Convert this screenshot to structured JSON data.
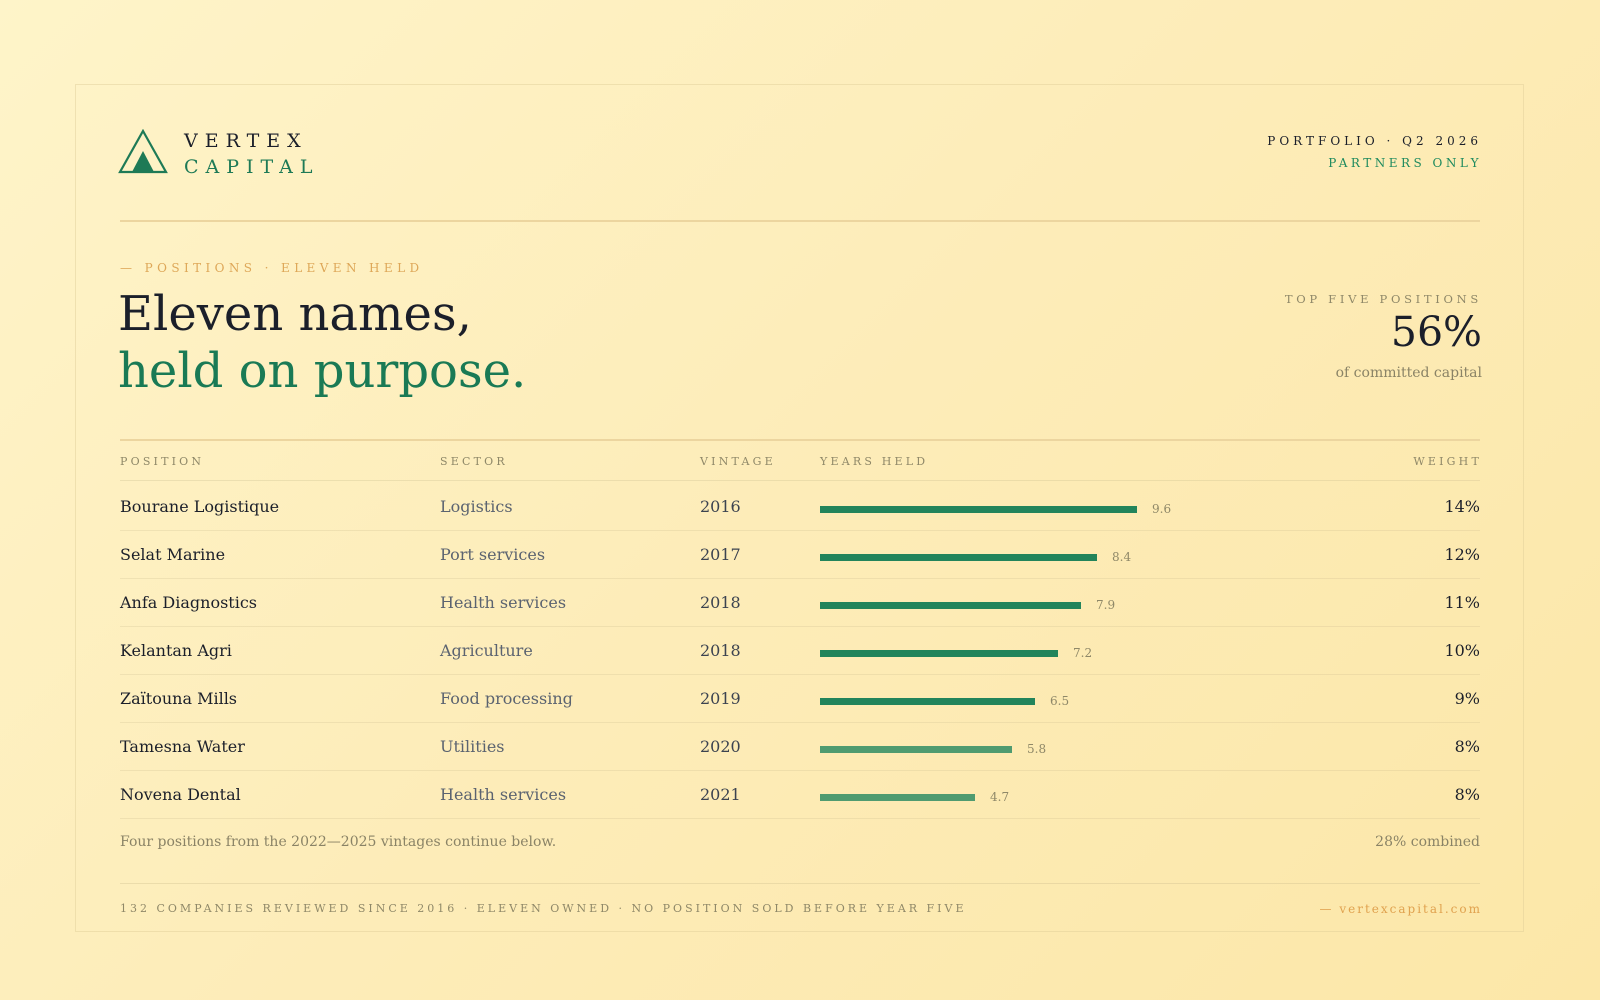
{
  "brand": {
    "line1": "VERTEX",
    "line2": "CAPITAL"
  },
  "header": {
    "meta_line1": "PORTFOLIO · Q2 2026",
    "meta_line2": "PARTNERS ONLY"
  },
  "kicker": "— POSITIONS · ELEVEN HELD",
  "headline": {
    "line1": "Eleven names,",
    "line2": "held on purpose."
  },
  "stat": {
    "label": "TOP FIVE POSITIONS",
    "value": "56%",
    "sub": "of committed capital"
  },
  "table": {
    "columns": [
      "POSITION",
      "SECTOR",
      "VINTAGE",
      "YEARS HELD",
      "WEIGHT"
    ],
    "max_years": 9.6,
    "rows": [
      {
        "name": "Bourane Logistique",
        "sector": "Logistics",
        "vintage": "2016",
        "years": 9.6,
        "years_label": "9.6",
        "weight": "14%"
      },
      {
        "name": "Selat Marine",
        "sector": "Port services",
        "vintage": "2017",
        "years": 8.4,
        "years_label": "8.4",
        "weight": "12%"
      },
      {
        "name": "Anfa Diagnostics",
        "sector": "Health services",
        "vintage": "2018",
        "years": 7.9,
        "years_label": "7.9",
        "weight": "11%"
      },
      {
        "name": "Kelantan Agri",
        "sector": "Agriculture",
        "vintage": "2018",
        "years": 7.2,
        "years_label": "7.2",
        "weight": "10%"
      },
      {
        "name": "Zaïtouna Mills",
        "sector": "Food processing",
        "vintage": "2019",
        "years": 6.5,
        "years_label": "6.5",
        "weight": "9%"
      },
      {
        "name": "Tamesna Water",
        "sector": "Utilities",
        "vintage": "2020",
        "years": 5.8,
        "years_label": "5.8",
        "weight": "8%"
      },
      {
        "name": "Novena Dental",
        "sector": "Health services",
        "vintage": "2021",
        "years": 4.7,
        "years_label": "4.7",
        "weight": "8%"
      }
    ]
  },
  "note": "Four positions from the 2022—2025 vintages continue below.",
  "combined": "28% combined",
  "footer": {
    "left": "132 COMPANIES REVIEWED SINCE 2016 · ELEVEN OWNED · NO POSITION SOLD BEFORE YEAR FIVE",
    "right": "— vertexcapital.com"
  },
  "colors": {
    "accent_green": "#1e7a56",
    "bar_green": "#22845b",
    "bar_light": "#4f9b70",
    "accent_orange": "#e0a24f",
    "ink": "#1b1f2a"
  }
}
